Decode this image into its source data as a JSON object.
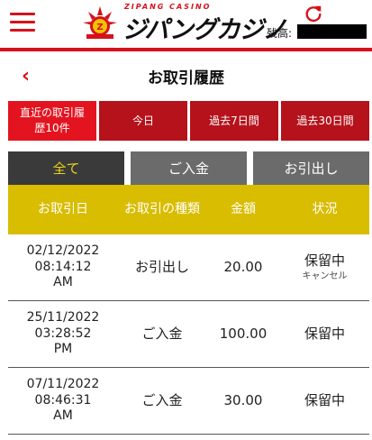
{
  "header": {
    "logo_small": "ZIPANG CASINO",
    "logo_main": "ジパングカジノ",
    "balance_label": "残高:",
    "balance_value": ""
  },
  "page": {
    "title": "お取引履歴",
    "back": "‹"
  },
  "period_tabs": [
    {
      "label": "直近の取引履歴10件",
      "active": true
    },
    {
      "label": "今日",
      "active": false
    },
    {
      "label": "過去7日間",
      "active": false
    },
    {
      "label": "過去30日間",
      "active": false
    }
  ],
  "type_tabs": [
    {
      "label": "全て",
      "active": true
    },
    {
      "label": "ご入金",
      "active": false
    },
    {
      "label": "お引出し",
      "active": false
    }
  ],
  "table": {
    "columns": [
      "お取引日",
      "お取引の種類",
      "金額",
      "状況"
    ],
    "rows": [
      {
        "date": "02/12/2022",
        "time": "08:14:12",
        "ampm": "AM",
        "type": "お引出し",
        "amount": "20.00",
        "status": "保留中",
        "sub": "キャンセル"
      },
      {
        "date": "25/11/2022",
        "time": "03:28:52",
        "ampm": "PM",
        "type": "ご入金",
        "amount": "100.00",
        "status": "保留中",
        "sub": ""
      },
      {
        "date": "07/11/2022",
        "time": "08:46:31",
        "ampm": "AM",
        "type": "ご入金",
        "amount": "30.00",
        "status": "保留中",
        "sub": ""
      }
    ]
  },
  "colors": {
    "brand_red": "#d7111b",
    "tab_red": "#b5121b",
    "header_yellow": "#d8bd00",
    "active_text_yellow": "#ecd21a"
  },
  "icons": {
    "menu": "hamburger-menu-icon",
    "reload": "reload-icon",
    "back": "chevron-left-icon"
  }
}
